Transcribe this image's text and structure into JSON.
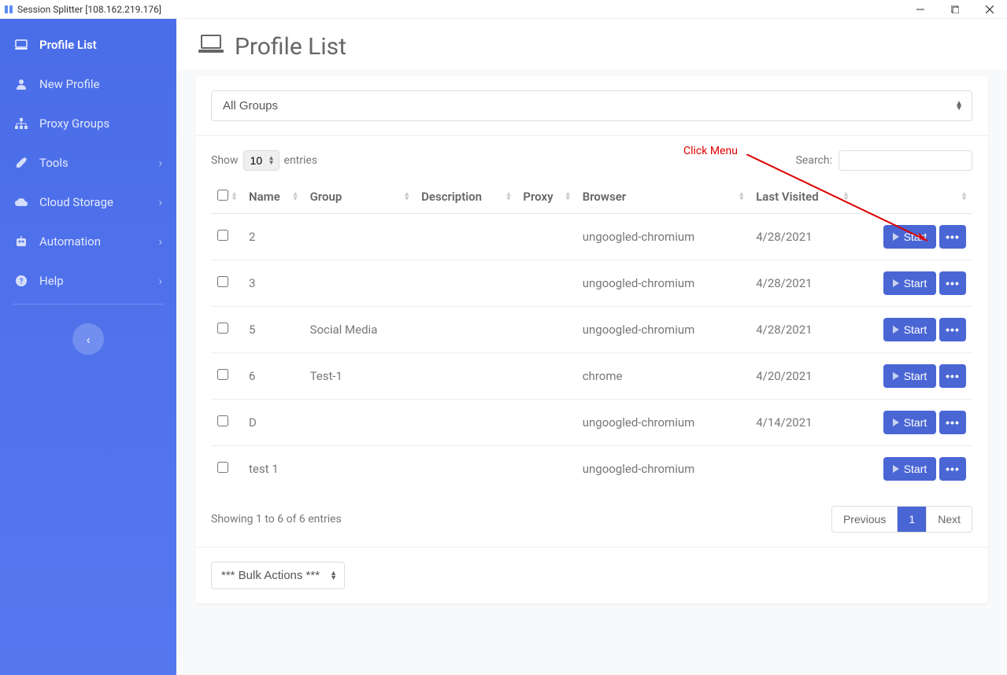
{
  "window": {
    "title": "Session Splitter [108.162.219.176]"
  },
  "sidebar": {
    "items": [
      {
        "label": "Profile List",
        "icon": "monitor",
        "active": true
      },
      {
        "label": "New Profile",
        "icon": "user"
      },
      {
        "label": "Proxy Groups",
        "icon": "sitemap"
      },
      {
        "label": "Tools",
        "icon": "wrench",
        "hasSubmenu": true
      },
      {
        "label": "Cloud Storage",
        "icon": "cloud",
        "hasSubmenu": true
      },
      {
        "label": "Automation",
        "icon": "robot",
        "hasSubmenu": true
      },
      {
        "label": "Help",
        "icon": "help",
        "hasSubmenu": true
      }
    ]
  },
  "page": {
    "title": "Profile List"
  },
  "groupFilter": {
    "selected": "All Groups"
  },
  "table": {
    "showLabel": "Show",
    "entriesLabel": "entries",
    "entriesValue": "10",
    "searchLabel": "Search:",
    "columns": [
      "",
      "Name",
      "Group",
      "Description",
      "Proxy",
      "Browser",
      "Last Visited",
      ""
    ],
    "rows": [
      {
        "name": "2",
        "group": "",
        "description": "",
        "proxy": "",
        "browser": "ungoogled-chromium",
        "lastVisited": "4/28/2021"
      },
      {
        "name": "3",
        "group": "",
        "description": "",
        "proxy": "",
        "browser": "ungoogled-chromium",
        "lastVisited": "4/28/2021"
      },
      {
        "name": "5",
        "group": "Social Media",
        "description": "",
        "proxy": "",
        "browser": "ungoogled-chromium",
        "lastVisited": "4/28/2021"
      },
      {
        "name": "6",
        "group": "Test-1",
        "description": "",
        "proxy": "",
        "browser": "chrome",
        "lastVisited": "4/20/2021"
      },
      {
        "name": "D",
        "group": "",
        "description": "",
        "proxy": "",
        "browser": "ungoogled-chromium",
        "lastVisited": "4/14/2021"
      },
      {
        "name": "test 1",
        "group": "",
        "description": "",
        "proxy": "",
        "browser": "ungoogled-chromium",
        "lastVisited": ""
      }
    ],
    "startButton": "Start",
    "infoText": "Showing 1 to 6 of 6 entries"
  },
  "pagination": {
    "prev": "Previous",
    "pages": [
      "1"
    ],
    "next": "Next",
    "active": "1"
  },
  "bulkActions": {
    "placeholder": "*** Bulk Actions ***"
  },
  "annotation": {
    "text": "Click Menu"
  }
}
